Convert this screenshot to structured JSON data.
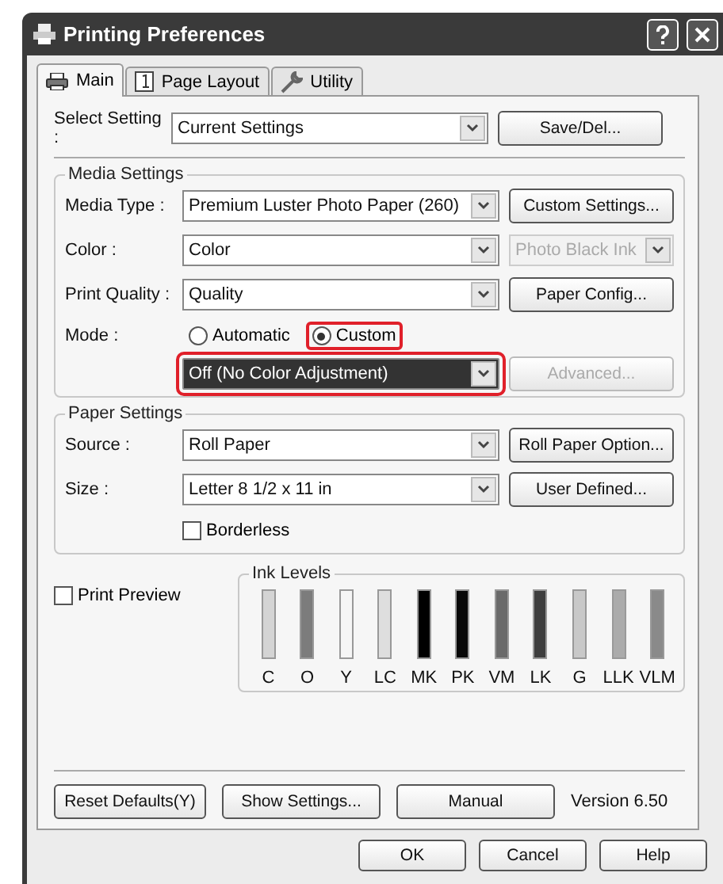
{
  "window": {
    "title": "Printing Preferences"
  },
  "tabs": [
    {
      "label": "Main",
      "kind": "printer",
      "selected": true
    },
    {
      "label": "Page Layout",
      "kind": "page",
      "selected": false
    },
    {
      "label": "Utility",
      "kind": "wrench",
      "selected": false
    }
  ],
  "select_setting": {
    "label": "Select Setting :",
    "value": "Current Settings",
    "button": "Save/Del..."
  },
  "media_settings": {
    "title": "Media Settings",
    "rows": [
      {
        "label": "Media Type :",
        "value": "Premium Luster Photo Paper (260)",
        "side": {
          "kind": "button",
          "label": "Custom Settings...",
          "disabled": false
        }
      },
      {
        "label": "Color :",
        "value": "Color",
        "side": {
          "kind": "select",
          "label": "Photo Black Ink",
          "disabled": true
        }
      },
      {
        "label": "Print Quality :",
        "value": "Quality",
        "side": {
          "kind": "button",
          "label": "Paper Config...",
          "disabled": false
        }
      }
    ],
    "mode": {
      "label": "Mode :",
      "options": [
        {
          "label": "Automatic",
          "selected": false,
          "highlighted": false
        },
        {
          "label": "Custom",
          "selected": true,
          "highlighted": true
        }
      ],
      "select": {
        "value": "Off (No Color Adjustment)",
        "focused": true,
        "highlighted": true
      },
      "button": {
        "label": "Advanced...",
        "disabled": true
      }
    }
  },
  "paper_settings": {
    "title": "Paper Settings",
    "rows": [
      {
        "label": "Source :",
        "value": "Roll Paper",
        "side": {
          "kind": "button",
          "label": "Roll Paper Option...",
          "disabled": false
        }
      },
      {
        "label": "Size :",
        "value": "Letter 8 1/2 x 11 in",
        "side": {
          "kind": "button",
          "label": "User Defined...",
          "disabled": false
        }
      }
    ],
    "borderless": {
      "label": "Borderless",
      "checked": false
    }
  },
  "print_preview": {
    "label": "Print Preview",
    "checked": false
  },
  "ink_levels": {
    "title": "Ink Levels",
    "inks": [
      {
        "label": "C",
        "color": "#d4d4d4",
        "level": 1
      },
      {
        "label": "O",
        "color": "#7c7c7c",
        "level": 1
      },
      {
        "label": "Y",
        "color": "#f6f6f6",
        "level": 1
      },
      {
        "label": "LC",
        "color": "#dedede",
        "level": 1
      },
      {
        "label": "MK",
        "color": "#000000",
        "level": 1
      },
      {
        "label": "PK",
        "color": "#080808",
        "level": 1
      },
      {
        "label": "VM",
        "color": "#6a6a6a",
        "level": 1
      },
      {
        "label": "LK",
        "color": "#3e3e3e",
        "level": 1
      },
      {
        "label": "G",
        "color": "#c8c8c8",
        "level": 1
      },
      {
        "label": "LLK",
        "color": "#ababab",
        "level": 1
      },
      {
        "label": "VLM",
        "color": "#8a8a8a",
        "level": 1
      }
    ]
  },
  "bottom_buttons": [
    "Reset Defaults(Y)",
    "Show Settings...",
    "Manual"
  ],
  "version": "Version 6.50",
  "dialog_buttons": [
    "OK",
    "Cancel",
    "Help"
  ]
}
